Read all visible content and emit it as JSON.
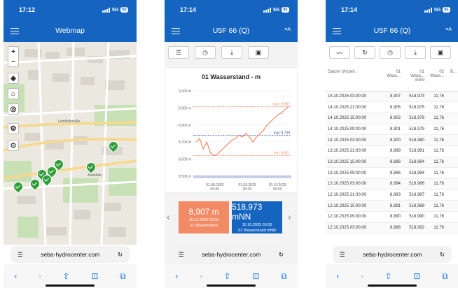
{
  "status": {
    "network": "5G"
  },
  "phones": [
    {
      "time": "17:12",
      "battery": "82",
      "title": "Webmap",
      "url": "seba-hydrocenter.com"
    },
    {
      "time": "17:14",
      "battery": "81",
      "title": "U5F 66 (Q)",
      "url": "seba-hydrocenter.com"
    },
    {
      "time": "17:14",
      "battery": "81",
      "title": "U5F 66 (Q)",
      "url": "seba-hydrocenter.com"
    }
  ],
  "map": {
    "zoom_in": "+",
    "zoom_out": "−",
    "street_labels": [
      "Leinfeldstraße",
      "Aumühle"
    ]
  },
  "chart_data": {
    "type": "line",
    "title": "01 Wasserstand - m",
    "ylim": [
      8.48,
      9.02
    ],
    "yticks": [
      "9,000 m",
      "8,900 m",
      "8,800 m",
      "8,700 m",
      "8,600 m",
      "8,500 m"
    ],
    "xticks": [
      "01.08.2025\n00:00",
      "01.09.2025\n00:00",
      "01.10.2025\n00:00"
    ],
    "x_ticks_short": [
      [
        "01.08.2025",
        "00:00"
      ],
      [
        "01.09.2025",
        "00:00"
      ],
      [
        "01.10.2025",
        "00:00"
      ]
    ],
    "max_label": "max: 8,907",
    "avg_label": "avg: 8,739",
    "min_label": "min: 8,621",
    "max": 8.907,
    "avg": 8.739,
    "min": 8.621,
    "series": [
      {
        "values": [
          8.7,
          8.72,
          8.66,
          8.7,
          8.64,
          8.62,
          8.63,
          8.65,
          8.67,
          8.69,
          8.71,
          8.72,
          8.74,
          8.73,
          8.75,
          8.73,
          8.7,
          8.73,
          8.75,
          8.77,
          8.8,
          8.82,
          8.84,
          8.86,
          8.87,
          8.89,
          8.907
        ]
      }
    ]
  },
  "tiles": [
    {
      "value": "8,907 m",
      "date": "15.10.2025 03:00",
      "label": "01 Wasserstand"
    },
    {
      "value": "518,973 mNN",
      "date": "15.10.2025 03:00",
      "label": "01 Wasserstand mNN"
    }
  ],
  "table": {
    "headers": [
      "Datum Uhrzeit",
      "01\nWass...",
      "01\nWass...\nmNN",
      "02\nWass...",
      "B..."
    ],
    "rows": [
      [
        "15.10.2025 03:00:00",
        "8,907",
        "518,973",
        "11,76"
      ],
      [
        "14.10.2025 21:00:00",
        "8,905",
        "518,975",
        "11,76"
      ],
      [
        "14.10.2025 15:00:00",
        "8,902",
        "518,978",
        "11,76"
      ],
      [
        "14.10.2025 09:00:00",
        "8,901",
        "518,979",
        "11,76"
      ],
      [
        "14.10.2025 03:00:00",
        "8,900",
        "518,980",
        "11,76"
      ],
      [
        "13.10.2025 21:00:00",
        "8,899",
        "518,981",
        "11,76"
      ],
      [
        "13.10.2025 15:00:00",
        "8,896",
        "518,984",
        "11,76"
      ],
      [
        "13.10.2025 09:00:00",
        "8,896",
        "518,984",
        "11,76"
      ],
      [
        "13.10.2025 03:00:00",
        "8,894",
        "518,986",
        "11,76"
      ],
      [
        "12.10.2025 21:00:00",
        "8,893",
        "518,987",
        "11,76"
      ],
      [
        "12.10.2025 15:00:00",
        "8,891",
        "518,989",
        "11,76"
      ],
      [
        "12.10.2025 09:00:00",
        "8,890",
        "518,990",
        "11,76"
      ],
      [
        "12.10.2025 03:00:00",
        "8,888",
        "518,992",
        "11,76"
      ]
    ]
  }
}
